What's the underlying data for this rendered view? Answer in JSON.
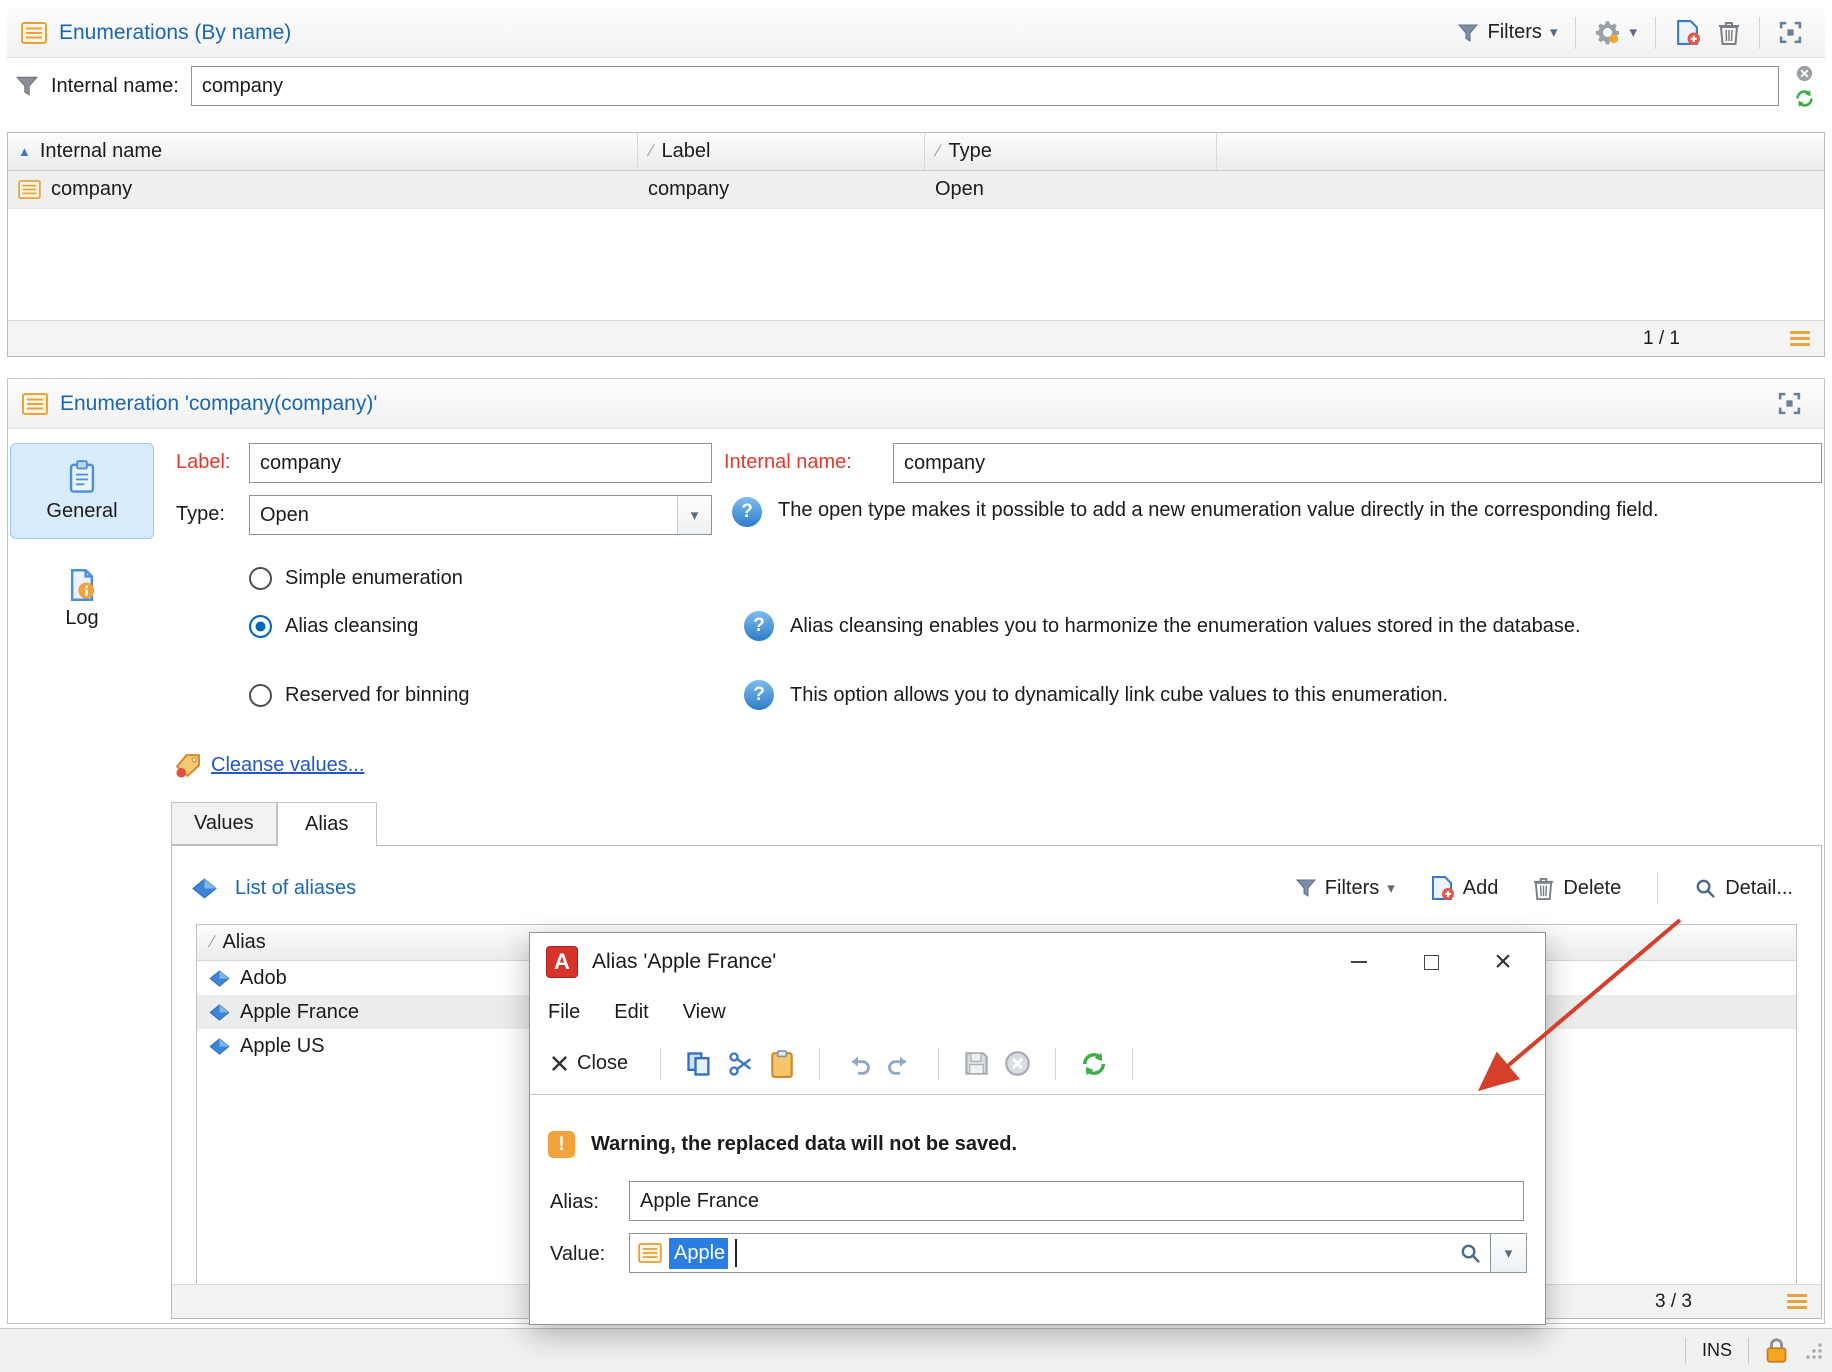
{
  "colors": {
    "title_blue": "#1a66b0",
    "label_red": "#e03a2f",
    "link_blue": "#2457c5",
    "selection_blue": "#2a7de1",
    "warning_orange": "#f2a33c",
    "arrow_red": "#d4402b",
    "sidebar_selected_blue": "#d9ecfb"
  },
  "icons": {
    "chevron_down": "▾",
    "sort_ascending": "▲",
    "sort_column": "/",
    "close": "×",
    "help": "?",
    "warning": "!"
  },
  "browser": {
    "title": "Enumerations (By name)",
    "filters_button": "Filters",
    "filter_label": "Internal name:",
    "filter_value": "company",
    "columns": [
      "Internal name",
      "Label",
      "Type"
    ],
    "row": {
      "internal_name": "company",
      "label": "company",
      "type": "Open"
    },
    "pager": "1 / 1"
  },
  "detail": {
    "title": "Enumeration 'company(company)'",
    "sidebar": {
      "general": "General",
      "log": "Log"
    },
    "form": {
      "label_caption": "Label:",
      "label_value": "company",
      "internal_caption": "Internal name:",
      "internal_value": "company",
      "type_caption": "Type:",
      "type_value": "Open",
      "type_help": "The open type makes it possible to add a new enumeration value directly in the corresponding field.",
      "radio_simple": "Simple enumeration",
      "radio_alias": "Alias cleansing",
      "radio_binning": "Reserved for binning",
      "alias_help": "Alias cleansing enables you to harmonize the enumeration values stored in the database.",
      "binning_help": "This option allows you to dynamically link cube values to this enumeration.",
      "cleanse_link": "Cleanse values..."
    },
    "tabs": {
      "values": "Values",
      "alias": "Alias"
    },
    "alias_list": {
      "title": "List of aliases",
      "filters_button": "Filters",
      "add_button": "Add",
      "delete_button": "Delete",
      "detail_button": "Detail...",
      "column": "Alias",
      "rows": [
        "Adob",
        "Apple France",
        "Apple US"
      ],
      "selected_row": "Apple France",
      "pager": "3 / 3"
    }
  },
  "dialog": {
    "title": "Alias 'Apple France'",
    "menu": [
      "File",
      "Edit",
      "View"
    ],
    "close_button": "Close",
    "warning_text": "Warning, the replaced data will not be saved.",
    "alias_caption": "Alias:",
    "alias_value": "Apple France",
    "value_caption": "Value:",
    "value_text": "Apple"
  },
  "status_bar": {
    "insert_mode": "INS"
  }
}
